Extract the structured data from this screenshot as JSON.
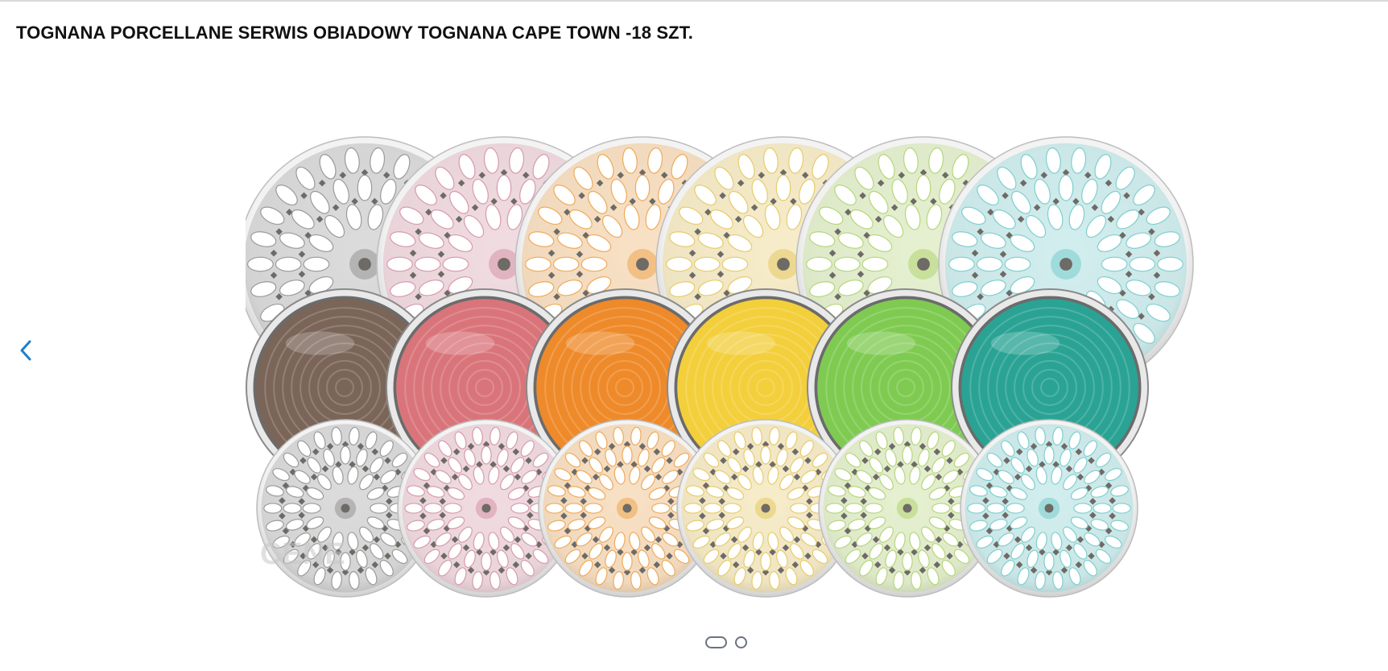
{
  "product": {
    "title": "TOGNANA PORCELLANE SERWIS OBIADOWY TOGNANA CAPE TOWN -18 SZT."
  },
  "gallery": {
    "watermark": "CENE",
    "prev_icon": "chevron-left-icon",
    "slide_count": 2,
    "active_slide": 1
  },
  "colors": {
    "accent": "#1e7fcb",
    "title": "#111111",
    "dot": "#6b7280",
    "bowls": [
      "#7a6558",
      "#d9757a",
      "#ee8a2a",
      "#f3cf3c",
      "#7fcb52",
      "#2aa394"
    ],
    "pattern_tints": [
      "#9a9a9a",
      "#d79aad",
      "#efaa5a",
      "#e7cb6a",
      "#b6d67a",
      "#7fcfcf"
    ]
  }
}
